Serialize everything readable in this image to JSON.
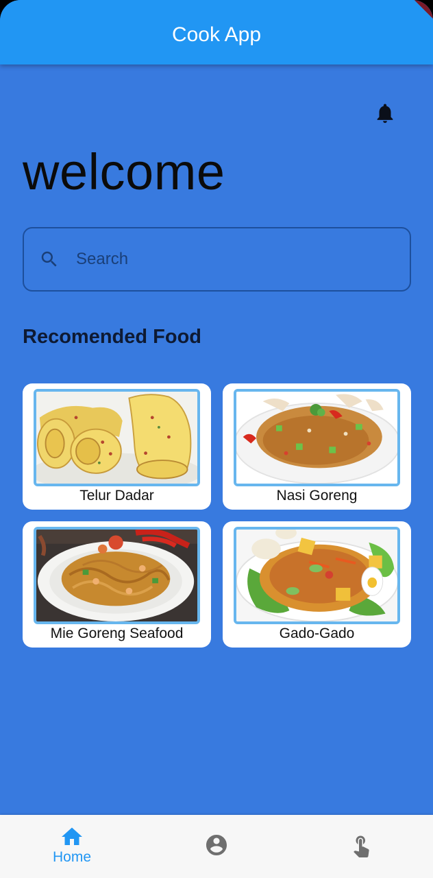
{
  "app": {
    "title": "Cook App"
  },
  "page": {
    "welcome": "welcome",
    "section_title": "Recomended Food"
  },
  "search": {
    "placeholder": "Search"
  },
  "foods": [
    {
      "name": "Telur Dadar"
    },
    {
      "name": "Nasi Goreng"
    },
    {
      "name": "Mie Goreng Seafood"
    },
    {
      "name": "Gado-Gado"
    }
  ],
  "nav": {
    "home_label": "Home",
    "active": "home",
    "items": [
      "home-icon",
      "account-circle-icon",
      "touch-app-icon"
    ]
  },
  "icons": {
    "header": "notifications-icon",
    "search": "search-icon"
  },
  "colors": {
    "appbar": "#2196F3",
    "background": "#387ADF",
    "accent": "#2196F3",
    "card": "#FFFFFF",
    "image_border": "#67B6EE"
  }
}
